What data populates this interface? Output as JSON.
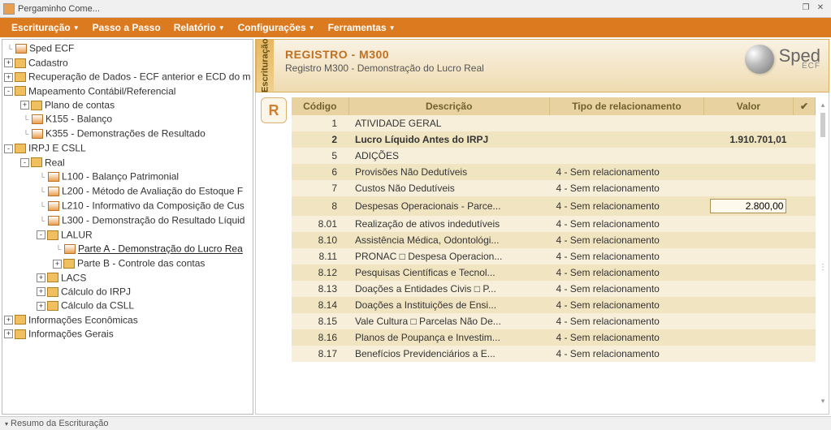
{
  "window": {
    "title": "Pergaminho Come..."
  },
  "menu": {
    "items": [
      "Escrituração",
      "Passo a Passo",
      "Relatório",
      "Configurações",
      "Ferramentas"
    ]
  },
  "tree": [
    {
      "depth": 0,
      "toggle": "",
      "icon": "doc",
      "label": "Sped ECF"
    },
    {
      "depth": 0,
      "toggle": "+",
      "icon": "folder",
      "label": "Cadastro"
    },
    {
      "depth": 0,
      "toggle": "+",
      "icon": "folder",
      "label": "Recuperação de Dados - ECF anterior e ECD do m"
    },
    {
      "depth": 0,
      "toggle": "-",
      "icon": "folder",
      "label": "Mapeamento Contábil/Referencial"
    },
    {
      "depth": 1,
      "toggle": "+",
      "icon": "folder",
      "label": "Plano de contas"
    },
    {
      "depth": 1,
      "toggle": "",
      "icon": "doc",
      "label": "K155 - Balanço"
    },
    {
      "depth": 1,
      "toggle": "",
      "icon": "doc",
      "label": "K355 - Demonstrações de Resultado"
    },
    {
      "depth": 0,
      "toggle": "-",
      "icon": "folder",
      "label": "IRPJ E CSLL"
    },
    {
      "depth": 1,
      "toggle": "-",
      "icon": "folder",
      "label": "Real"
    },
    {
      "depth": 2,
      "toggle": "",
      "icon": "doc",
      "label": "L100 - Balanço Patrimonial"
    },
    {
      "depth": 2,
      "toggle": "",
      "icon": "doc",
      "label": "L200 - Método de Avaliação do Estoque F"
    },
    {
      "depth": 2,
      "toggle": "",
      "icon": "doc",
      "label": "L210 - Informativo da Composição de Cus"
    },
    {
      "depth": 2,
      "toggle": "",
      "icon": "doc",
      "label": "L300 - Demonstração do Resultado Líquid"
    },
    {
      "depth": 2,
      "toggle": "-",
      "icon": "folder",
      "label": "LALUR"
    },
    {
      "depth": 3,
      "toggle": "",
      "icon": "doc",
      "label": "Parte A - Demonstração do Lucro Rea",
      "selected": true
    },
    {
      "depth": 3,
      "toggle": "+",
      "icon": "folder",
      "label": "Parte B - Controle das contas"
    },
    {
      "depth": 2,
      "toggle": "+",
      "icon": "folder",
      "label": "LACS"
    },
    {
      "depth": 2,
      "toggle": "+",
      "icon": "folder",
      "label": "Cálculo do IRPJ"
    },
    {
      "depth": 2,
      "toggle": "+",
      "icon": "folder",
      "label": "Cálculo da CSLL"
    },
    {
      "depth": 0,
      "toggle": "+",
      "icon": "folder",
      "label": "Informações Econômicas"
    },
    {
      "depth": 0,
      "toggle": "+",
      "icon": "folder",
      "label": "Informações Gerais"
    }
  ],
  "register": {
    "vertical_tab": "Escrituração",
    "title": "REGISTRO - M300",
    "subtitle": "Registro M300 - Demonstração do Lucro Real",
    "logo_text": "Sped",
    "logo_sub": "ECF",
    "r_button": "R"
  },
  "grid": {
    "headers": [
      "Código",
      "Descrição",
      "Tipo de relacionamento",
      "Valor",
      "✔"
    ],
    "rows": [
      {
        "code": "1",
        "desc": "ATIVIDADE GERAL",
        "rel": "",
        "val": "",
        "bold": false
      },
      {
        "code": "2",
        "desc": "Lucro Líquido Antes do IRPJ",
        "rel": "",
        "val": "1.910.701,01",
        "bold": true
      },
      {
        "code": "5",
        "desc": "ADIÇÕES",
        "rel": "",
        "val": "",
        "bold": false
      },
      {
        "code": "6",
        "desc": "Provisões Não Dedutíveis",
        "rel": "4 - Sem relacionamento",
        "val": "",
        "bold": false
      },
      {
        "code": "7",
        "desc": "Custos Não Dedutíveis",
        "rel": "4 - Sem relacionamento",
        "val": "",
        "bold": false
      },
      {
        "code": "8",
        "desc": "Despesas Operacionais - Parce...",
        "rel": "4 - Sem relacionamento",
        "val": "2.800,00",
        "bold": false,
        "editing": true
      },
      {
        "code": "8.01",
        "desc": "Realização de ativos indedutíveis",
        "rel": "4 - Sem relacionamento",
        "val": "",
        "bold": false
      },
      {
        "code": "8.10",
        "desc": "Assistência Médica, Odontológi...",
        "rel": "4 - Sem relacionamento",
        "val": "",
        "bold": false
      },
      {
        "code": "8.11",
        "desc": "PRONAC □ Despesa Operacion...",
        "rel": "4 - Sem relacionamento",
        "val": "",
        "bold": false
      },
      {
        "code": "8.12",
        "desc": "Pesquisas Científicas e Tecnol...",
        "rel": "4 - Sem relacionamento",
        "val": "",
        "bold": false
      },
      {
        "code": "8.13",
        "desc": "Doações a Entidades Civis □ P...",
        "rel": "4 - Sem relacionamento",
        "val": "",
        "bold": false
      },
      {
        "code": "8.14",
        "desc": "Doações a Instituições de Ensi...",
        "rel": "4 - Sem relacionamento",
        "val": "",
        "bold": false
      },
      {
        "code": "8.15",
        "desc": "Vale Cultura □ Parcelas Não De...",
        "rel": "4 - Sem relacionamento",
        "val": "",
        "bold": false
      },
      {
        "code": "8.16",
        "desc": "Planos de Poupança e Investim...",
        "rel": "4 - Sem relacionamento",
        "val": "",
        "bold": false
      },
      {
        "code": "8.17",
        "desc": "Benefícios Previdenciários a E...",
        "rel": "4 - Sem relacionamento",
        "val": "",
        "bold": false
      }
    ]
  },
  "footer": {
    "resumo": "Resumo da Escrituração"
  }
}
